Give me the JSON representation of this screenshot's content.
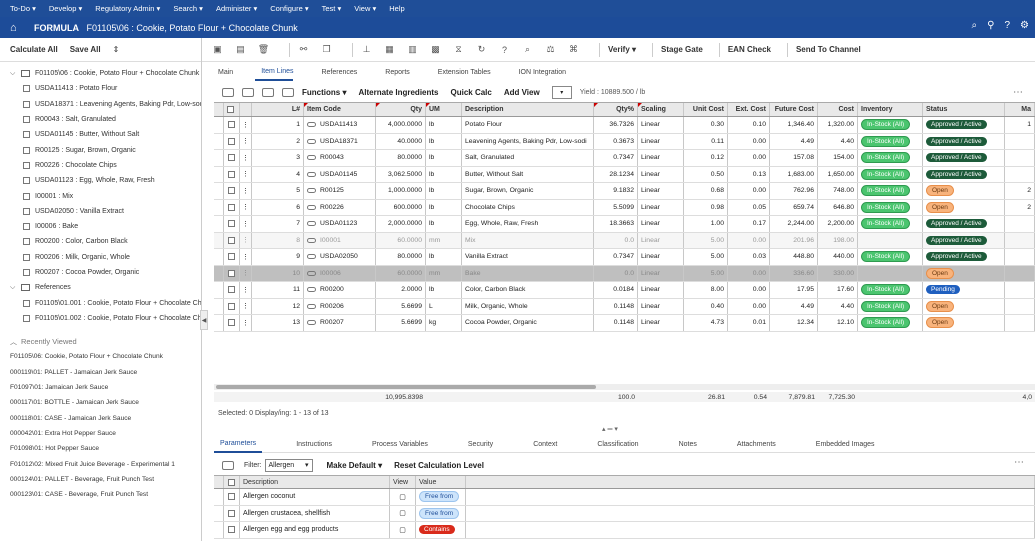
{
  "menu": [
    "To-Do",
    "Develop",
    "Regulatory Admin",
    "Search",
    "Administer",
    "Configure",
    "Test",
    "View",
    "Help"
  ],
  "title": {
    "app": "FORMULA",
    "record": "F01105\\06 : Cookie, Potato Flour + Chocolate Chunk"
  },
  "left": {
    "calc_all": "Calculate All",
    "save_all": "Save All",
    "tree_root": "F01105\\06 : Cookie, Potato Flour + Chocolate Chunk",
    "tree_items": [
      "USDA11413 : Potato Flour",
      "USDA18371 : Leavening Agents, Baking Pdr, Low-sod",
      "R00043 : Salt, Granulated",
      "USDA01145 : Butter, Without Salt",
      "R00125 : Sugar, Brown, Organic",
      "R00226 : Chocolate Chips",
      "USDA01123 : Egg, Whole, Raw, Fresh",
      "I00001 : Mix",
      "USDA02050 : Vanilla Extract",
      "I00006 : Bake",
      "R00200 : Color, Carbon Black",
      "R00206 : Milk, Organic, Whole",
      "R00207 : Cocoa Powder, Organic"
    ],
    "references_label": "References",
    "references": [
      "F01105\\01.001 : Cookie, Potato Flour + Chocolate Ch",
      "F01105\\01.002 : Cookie, Potato Flour + Chocolate Ch"
    ],
    "recent_label": "Recently Viewed",
    "recent": [
      "F01105\\06: Cookie, Potato Flour + Chocolate Chunk",
      "000119\\01: PALLET - Jamaican Jerk Sauce",
      "F01097\\01: Jamaican Jerk Sauce",
      "000117\\01: BOTTLE - Jamaican Jerk Sauce",
      "000118\\01: CASE - Jamaican Jerk Sauce",
      "000042\\01: Extra Hot Pepper Sauce",
      "F01098\\01: Hot Pepper Sauce",
      "F01012\\02: Mixed Fruit Juice Beverage - Experimental 1",
      "000124\\01: PALLET - Beverage, Fruit Punch Test",
      "000123\\01: CASE - Beverage, Fruit Punch Test"
    ]
  },
  "toolbar": {
    "verify": "Verify",
    "stage_gate": "Stage Gate",
    "ean_check": "EAN Check",
    "send": "Send To Channel"
  },
  "tabs": [
    "Main",
    "Item Lines",
    "References",
    "Reports",
    "Extension Tables",
    "ION Integration"
  ],
  "grid_toolbar": {
    "functions": "Functions",
    "alt_ing": "Alternate Ingredients",
    "quick_calc": "Quick Calc",
    "add_view": "Add View",
    "yield": "Yield : 10889.500 / lb"
  },
  "grid": {
    "headers": [
      "L#",
      "Item Code",
      "Qty",
      "UM",
      "Description",
      "Qty%",
      "Scaling",
      "Unit Cost",
      "Ext. Cost",
      "Future Cost",
      "Cost",
      "Inventory",
      "Status",
      "Ma"
    ],
    "rows": [
      {
        "n": "1",
        "code": "USDA11413",
        "qty": "4,000.0000",
        "um": "lb",
        "desc": "Potato Flour",
        "pct": "36.7326",
        "scal": "Linear",
        "uc": "0.30",
        "ec": "0.10",
        "fc": "1,346.40",
        "cost": "1,320.00",
        "inv": "In-Stock (All)",
        "status": "Approved / Active",
        "st": "appr",
        "ma": "1",
        "style": ""
      },
      {
        "n": "2",
        "code": "USDA18371",
        "qty": "40.0000",
        "um": "lb",
        "desc": "Leavening Agents, Baking Pdr, Low-sodi",
        "pct": "0.3673",
        "scal": "Linear",
        "uc": "0.11",
        "ec": "0.00",
        "fc": "4.49",
        "cost": "4.40",
        "inv": "In-Stock (All)",
        "status": "Approved / Active",
        "st": "appr",
        "ma": "",
        "style": ""
      },
      {
        "n": "3",
        "code": "R00043",
        "qty": "80.0000",
        "um": "lb",
        "desc": "Salt, Granulated",
        "pct": "0.7347",
        "scal": "Linear",
        "uc": "0.12",
        "ec": "0.00",
        "fc": "157.08",
        "cost": "154.00",
        "inv": "In-Stock (All)",
        "status": "Approved / Active",
        "st": "appr",
        "ma": "",
        "style": ""
      },
      {
        "n": "4",
        "code": "USDA01145",
        "qty": "3,062.5000",
        "um": "lb",
        "desc": "Butter, Without Salt",
        "pct": "28.1234",
        "scal": "Linear",
        "uc": "0.50",
        "ec": "0.13",
        "fc": "1,683.00",
        "cost": "1,650.00",
        "inv": "In-Stock (All)",
        "status": "Approved / Active",
        "st": "appr",
        "ma": "",
        "style": ""
      },
      {
        "n": "5",
        "code": "R00125",
        "qty": "1,000.0000",
        "um": "lb",
        "desc": "Sugar, Brown, Organic",
        "pct": "9.1832",
        "scal": "Linear",
        "uc": "0.68",
        "ec": "0.00",
        "fc": "762.96",
        "cost": "748.00",
        "inv": "In-Stock (All)",
        "status": "Open",
        "st": "open",
        "ma": "2",
        "style": ""
      },
      {
        "n": "6",
        "code": "R00226",
        "qty": "600.0000",
        "um": "lb",
        "desc": "Chocolate Chips",
        "pct": "5.5099",
        "scal": "Linear",
        "uc": "0.98",
        "ec": "0.05",
        "fc": "659.74",
        "cost": "646.80",
        "inv": "In-Stock (All)",
        "status": "Open",
        "st": "open",
        "ma": "2",
        "style": ""
      },
      {
        "n": "7",
        "code": "USDA01123",
        "qty": "2,000.0000",
        "um": "lb",
        "desc": "Egg, Whole, Raw, Fresh",
        "pct": "18.3663",
        "scal": "Linear",
        "uc": "1.00",
        "ec": "0.17",
        "fc": "2,244.00",
        "cost": "2,200.00",
        "inv": "In-Stock (All)",
        "status": "Approved / Active",
        "st": "appr",
        "ma": "",
        "style": ""
      },
      {
        "n": "8",
        "code": "I00001",
        "qty": "60.0000",
        "um": "mm",
        "desc": "Mix",
        "pct": "0.0",
        "scal": "Linear",
        "uc": "5.00",
        "ec": "0.00",
        "fc": "201.96",
        "cost": "198.00",
        "inv": "",
        "status": "Approved / Active",
        "st": "appr",
        "ma": "",
        "style": "dim"
      },
      {
        "n": "9",
        "code": "USDA02050",
        "qty": "80.0000",
        "um": "lb",
        "desc": "Vanilla Extract",
        "pct": "0.7347",
        "scal": "Linear",
        "uc": "5.00",
        "ec": "0.03",
        "fc": "448.80",
        "cost": "440.00",
        "inv": "In-Stock (All)",
        "status": "Approved / Active",
        "st": "appr",
        "ma": "",
        "style": ""
      },
      {
        "n": "10",
        "code": "I00006",
        "qty": "60.0000",
        "um": "mm",
        "desc": "Bake",
        "pct": "0.0",
        "scal": "Linear",
        "uc": "5.00",
        "ec": "0.00",
        "fc": "336.60",
        "cost": "330.00",
        "inv": "",
        "status": "Open",
        "st": "open",
        "ma": "",
        "style": "sel"
      },
      {
        "n": "11",
        "code": "R00200",
        "qty": "2.0000",
        "um": "lb",
        "desc": "Color, Carbon Black",
        "pct": "0.0184",
        "scal": "Linear",
        "uc": "8.00",
        "ec": "0.00",
        "fc": "17.95",
        "cost": "17.60",
        "inv": "In-Stock (All)",
        "status": "Pending",
        "st": "pend",
        "ma": "",
        "style": ""
      },
      {
        "n": "12",
        "code": "R00206",
        "qty": "5.6699",
        "um": "L",
        "desc": "Milk, Organic, Whole",
        "pct": "0.1148",
        "scal": "Linear",
        "uc": "0.40",
        "ec": "0.00",
        "fc": "4.49",
        "cost": "4.40",
        "inv": "In-Stock (All)",
        "status": "Open",
        "st": "open",
        "ma": "",
        "style": ""
      },
      {
        "n": "13",
        "code": "R00207",
        "qty": "5.6699",
        "um": "kg",
        "desc": "Cocoa Powder, Organic",
        "pct": "0.1148",
        "scal": "Linear",
        "uc": "4.73",
        "ec": "0.01",
        "fc": "12.34",
        "cost": "12.10",
        "inv": "In-Stock (All)",
        "status": "Open",
        "st": "open",
        "ma": "",
        "style": ""
      }
    ],
    "totals": {
      "qty": "10,995.8398",
      "pct": "100.0",
      "uc": "26.81",
      "ec": "0.54",
      "fc": "7,879.81",
      "cost": "7,725.30",
      "ma": "4,0"
    },
    "status_line": "Selected: 0   Display/ing: 1 - 13 of 13"
  },
  "bottom": {
    "tabs": [
      "Parameters",
      "Instructions",
      "Process Variables",
      "Security",
      "Context",
      "Classification",
      "Notes",
      "Attachments",
      "Embedded Images"
    ],
    "filter_label": "Filter:",
    "filter_value": "Allergen",
    "make_default": "Make Default",
    "reset_calc": "Reset Calculation Level",
    "headers": [
      "Description",
      "View",
      "Value"
    ],
    "rows": [
      {
        "desc": "Allergen coconut",
        "value": "Free from",
        "kind": "free"
      },
      {
        "desc": "Allergen crustacea, shellfish",
        "value": "Free from",
        "kind": "free"
      },
      {
        "desc": "Allergen egg and egg products",
        "value": "Contains",
        "kind": "cont"
      }
    ]
  }
}
